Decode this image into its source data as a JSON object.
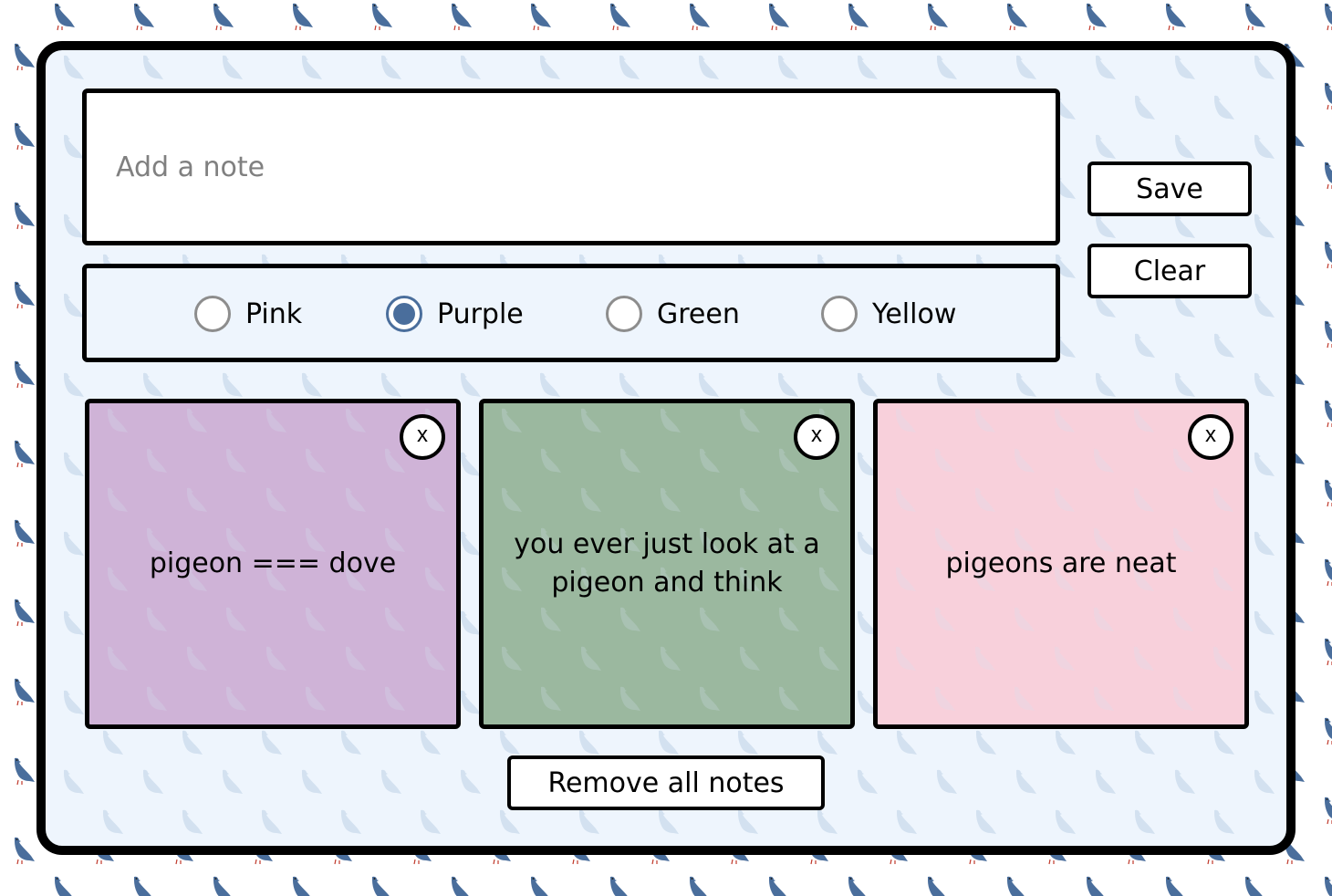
{
  "composer": {
    "placeholder": "Add a note",
    "value": "",
    "save_label": "Save",
    "clear_label": "Clear"
  },
  "colors": {
    "selected": "Purple",
    "options": [
      {
        "label": "Pink",
        "checked": false
      },
      {
        "label": "Purple",
        "checked": true
      },
      {
        "label": "Green",
        "checked": false
      },
      {
        "label": "Yellow",
        "checked": false
      }
    ]
  },
  "notes": [
    {
      "text": "pigeon === dove",
      "color": "#cfb3d7",
      "close_label": "x"
    },
    {
      "text": "you ever just look at a pigeon and think",
      "color": "#9bb89f",
      "close_label": "x"
    },
    {
      "text": "pigeons are neat",
      "color": "#f8d0db",
      "close_label": "x"
    }
  ],
  "remove_all_label": "Remove all notes",
  "theme": {
    "panel_bg": "#eef5fd",
    "pigeon_color": "#4a6e9c",
    "radio_accent": "#4a6e9c"
  }
}
